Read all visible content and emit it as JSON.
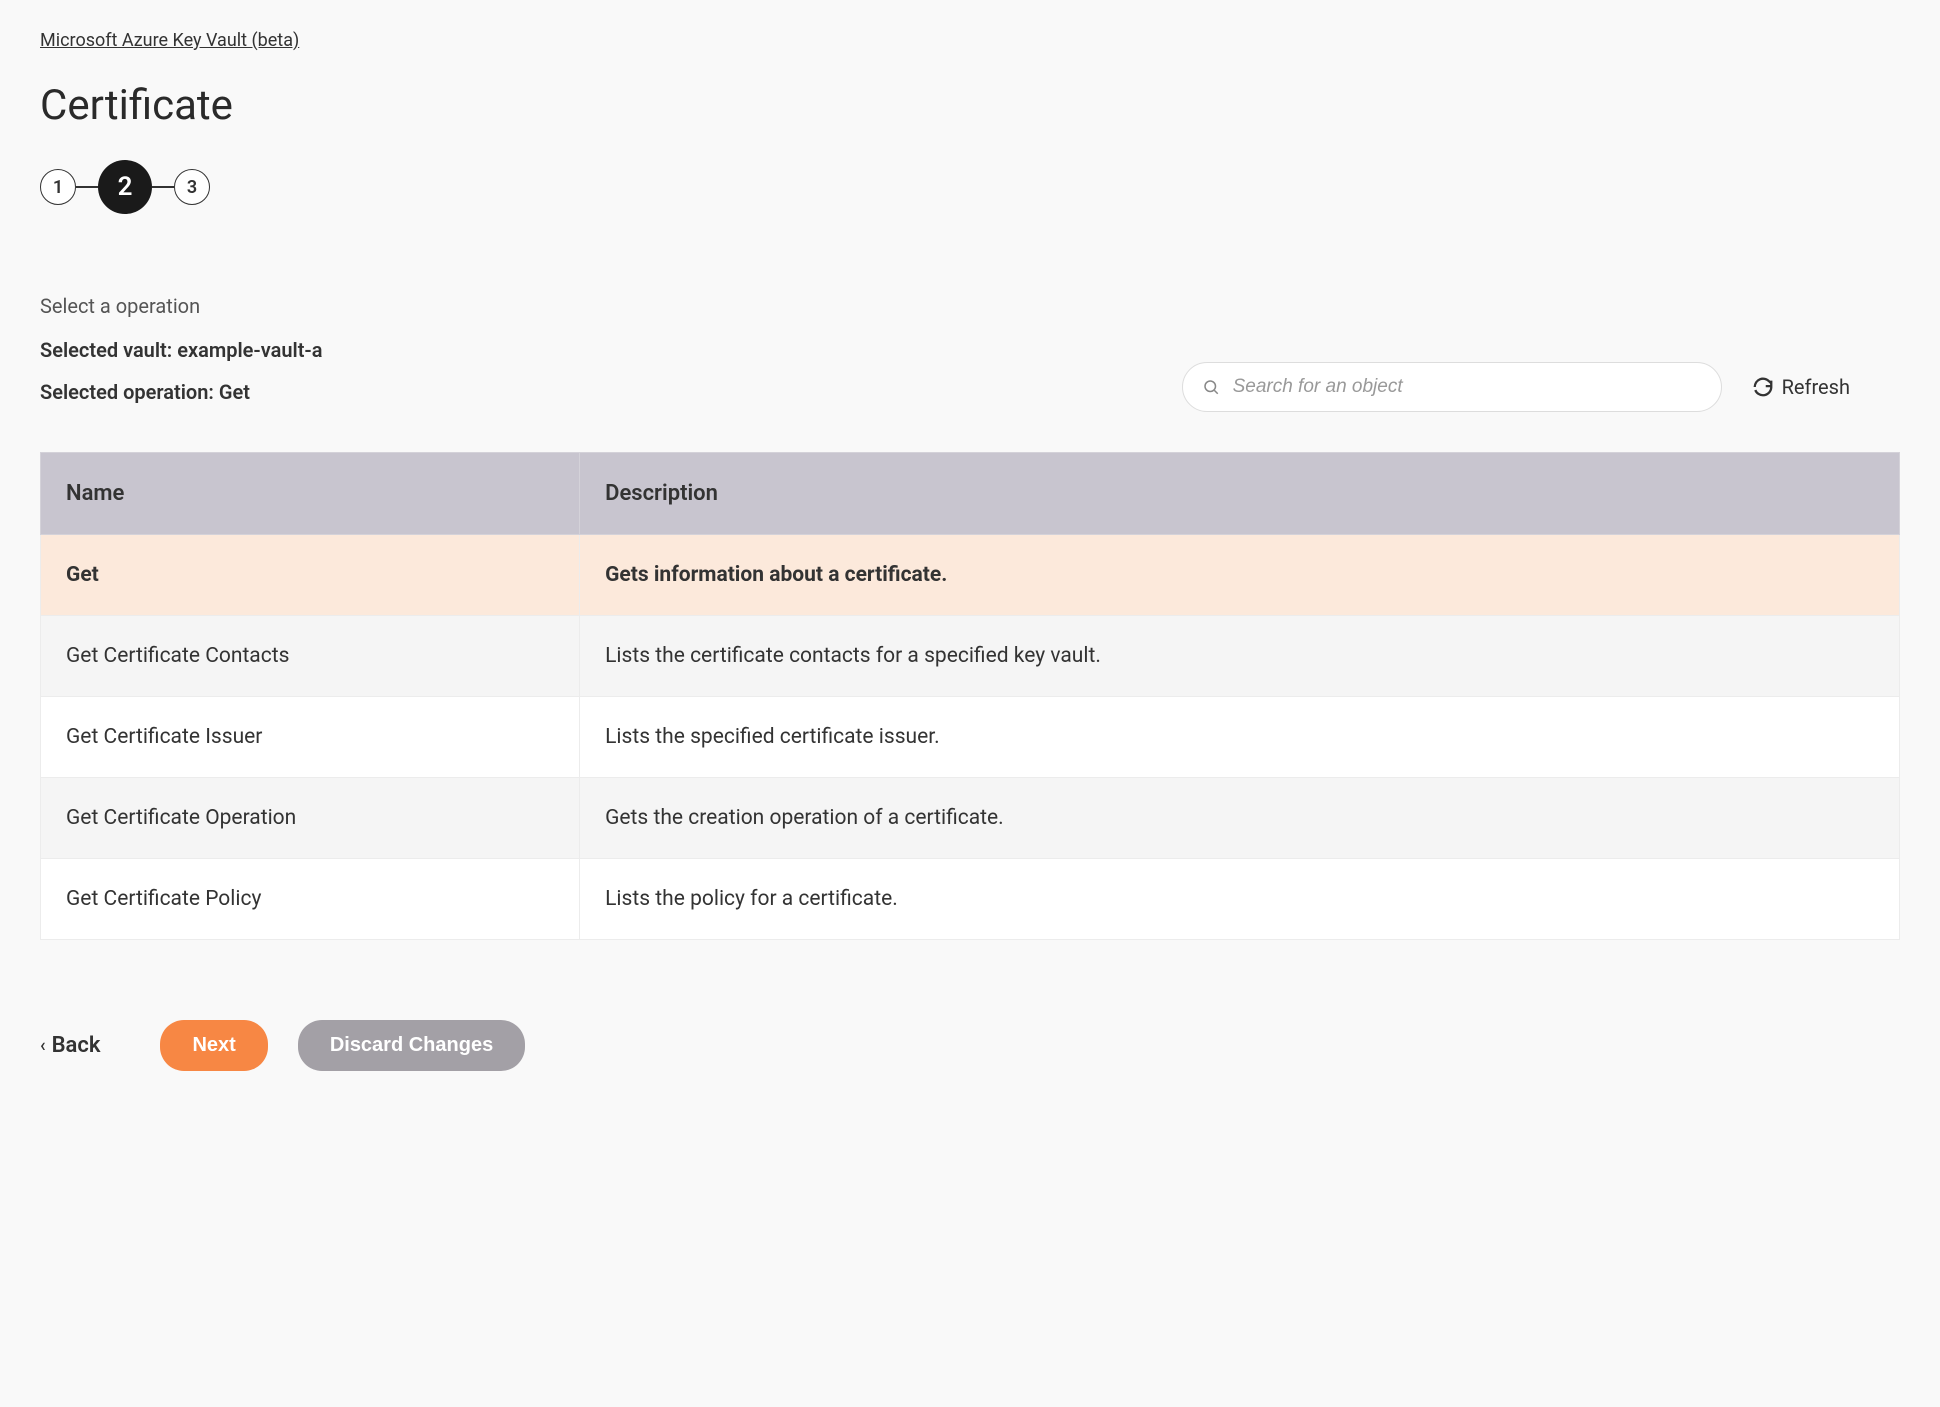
{
  "breadcrumb": {
    "label": "Microsoft Azure Key Vault (beta)"
  },
  "page_title": "Certificate",
  "stepper": {
    "steps": [
      "1",
      "2",
      "3"
    ],
    "active_index": 1
  },
  "instruction": "Select a operation",
  "selected_vault": {
    "label": "Selected vault:",
    "value": "example-vault-a"
  },
  "selected_operation": {
    "label": "Selected operation:",
    "value": "Get"
  },
  "search": {
    "placeholder": "Search for an object"
  },
  "refresh_label": "Refresh",
  "table": {
    "headers": {
      "name": "Name",
      "description": "Description"
    },
    "rows": [
      {
        "name": "Get",
        "description": "Gets information about a certificate.",
        "selected": true
      },
      {
        "name": "Get Certificate Contacts",
        "description": "Lists the certificate contacts for a specified key vault.",
        "selected": false
      },
      {
        "name": "Get Certificate Issuer",
        "description": "Lists the specified certificate issuer.",
        "selected": false
      },
      {
        "name": "Get Certificate Operation",
        "description": "Gets the creation operation of a certificate.",
        "selected": false
      },
      {
        "name": "Get Certificate Policy",
        "description": "Lists the policy for a certificate.",
        "selected": false
      }
    ]
  },
  "footer": {
    "back_label": "Back",
    "next_label": "Next",
    "discard_label": "Discard Changes"
  }
}
